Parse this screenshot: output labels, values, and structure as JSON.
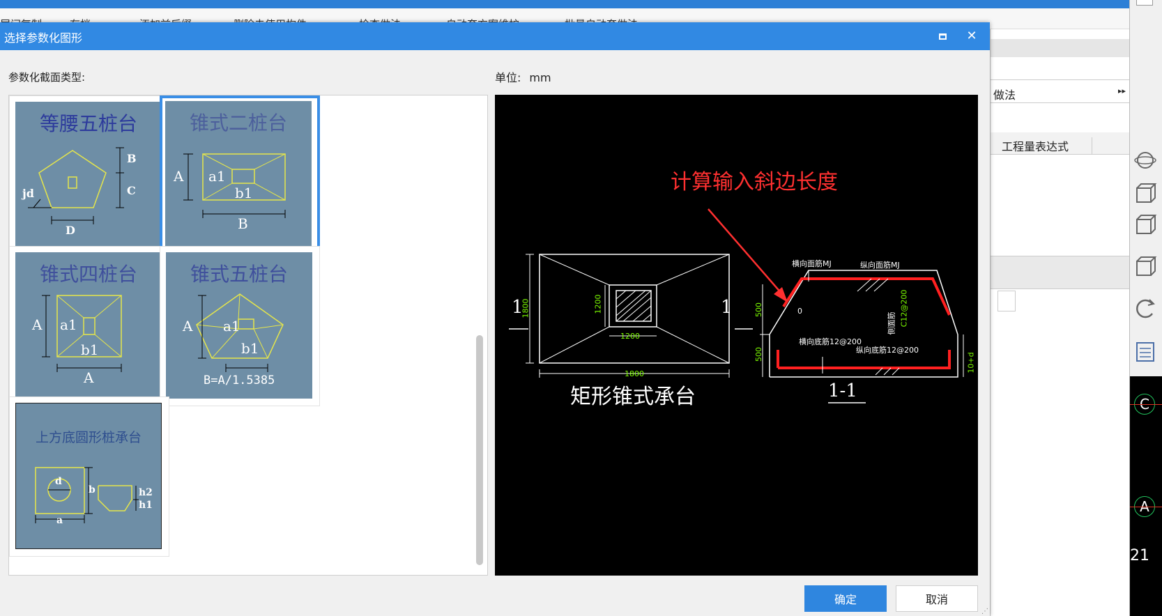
{
  "background": {
    "toolbar_items": [
      "层间复制",
      "存档",
      "添加前后缀",
      "删除未使用构件",
      "检查做法",
      "自动套方案维护",
      "批量自动套做法"
    ],
    "right_panel_title": "做法",
    "right_panel_more": "▸▸",
    "right_panel_column": "工程量表达式",
    "cad_axes": [
      "C",
      "A"
    ],
    "cad_number": "21"
  },
  "dialog": {
    "title": "选择参数化图形",
    "maximize_label": "",
    "close_label": "✕",
    "section_type_label": "参数化截面类型:",
    "unit_label": "单位:",
    "unit_value": "mm",
    "shapes": [
      {
        "name": "等腰五桩台",
        "labels": {
          "B": "B",
          "C": "C",
          "jd": "jd",
          "D": "D"
        }
      },
      {
        "name": "锥式二桩台",
        "labels": {
          "A": "A",
          "a1": "a1",
          "b1": "b1",
          "B": "B"
        }
      },
      {
        "name": "锥式四桩台",
        "labels": {
          "A": "A",
          "a1": "a1",
          "b1": "b1",
          "A2": "A"
        }
      },
      {
        "name": "锥式五桩台",
        "labels": {
          "A": "A",
          "a1": "a1",
          "b1": "b1",
          "formula": "B=A/1.5385"
        }
      },
      {
        "name": "上方底圆形桩承台",
        "labels": {
          "d": "d",
          "b": "b",
          "a": "a",
          "h2": "h2",
          "h1": "h1"
        }
      }
    ],
    "selected_index": 1,
    "preview": {
      "callout": "计算输入斜边长度",
      "caption": "矩形锥式承台",
      "section_label": "1-1",
      "section_mark_left": "1",
      "section_mark_right": "1",
      "dims": {
        "height_total": "1800",
        "inner_height": "1200",
        "inner_width": "1200",
        "width_total": "1800",
        "top_h": "500",
        "bottom_h": "500",
        "side": "10+d"
      },
      "notes": {
        "top_cross": "横向面筋MJ",
        "top_long": "纵向面筋MJ",
        "side_bar": "侧面筋",
        "side_spec": "C12@200",
        "bottom_cross": "横向底筋12@200",
        "bottom_long": "纵向底筋12@200",
        "slope": "0"
      }
    },
    "ok_label": "确定",
    "cancel_label": "取消"
  },
  "colors": {
    "titlebar": "#3189e3",
    "thumb_bg": "#6e8ea6",
    "shape_line": "#e6e64a",
    "selected_border": "#3a8ee6",
    "callout": "#ff3030",
    "rebar": "#ff2020",
    "dim_text": "#7cfc00"
  }
}
